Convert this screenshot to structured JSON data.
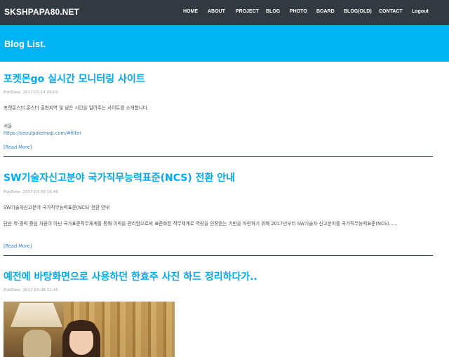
{
  "navbar": {
    "brand": "SKSHPAPA80.NET",
    "items": [
      {
        "label": "HOME"
      },
      {
        "label": "ABOUT"
      },
      {
        "label": "PROJECT"
      },
      {
        "label": "BLOG"
      },
      {
        "label": "PHOTO"
      },
      {
        "label": "BOARD"
      },
      {
        "label": "BLOG(OLD)"
      },
      {
        "label": "CONTACT"
      },
      {
        "label": "Logout"
      }
    ],
    "colors": {
      "background": "#323940",
      "text": "#ffffff"
    }
  },
  "header": {
    "title": "Blog List.",
    "color": "#00b4f3"
  },
  "posts": [
    {
      "title": "포켓몬go 실시간 모니터링 사이트",
      "date": "PubDate: 2017-03-14 09:03",
      "body": "포켓몬스터 몬스터 출현지역 및 남은 시간을 알려주는 사이트를 소개합니다.",
      "sub": "서울",
      "link": "https://seoulpokemap.com/#filter",
      "read_more": "[Read More]"
    },
    {
      "title": "SW기술자신고분야 국가직무능력표준(NCS) 전환 안내",
      "date": "PubDate: 2017-03-09 16:46",
      "body": "SW기술자신고분야 국가직무능력표준(NCS) 전환 안내",
      "detail": "단순 학·경력 중심 차원이 아닌 국가표준직무체계를 통해 이력을 관리함으로써 표준화된 직무체계로 역량을 인정받는 기반을 마련하기 위해 2017년부터 SW기술자 신고분야를 국가직무능력표준(NCS)......",
      "read_more": "[Read More]"
    },
    {
      "title": "예전에 바탕화면으로 사용하던 한효주 사진 하드 정리하다가..",
      "date": "PubDate: 2017-03-08 12:45",
      "image": "photo-of-person"
    }
  ],
  "accent_color": "#00aaee"
}
